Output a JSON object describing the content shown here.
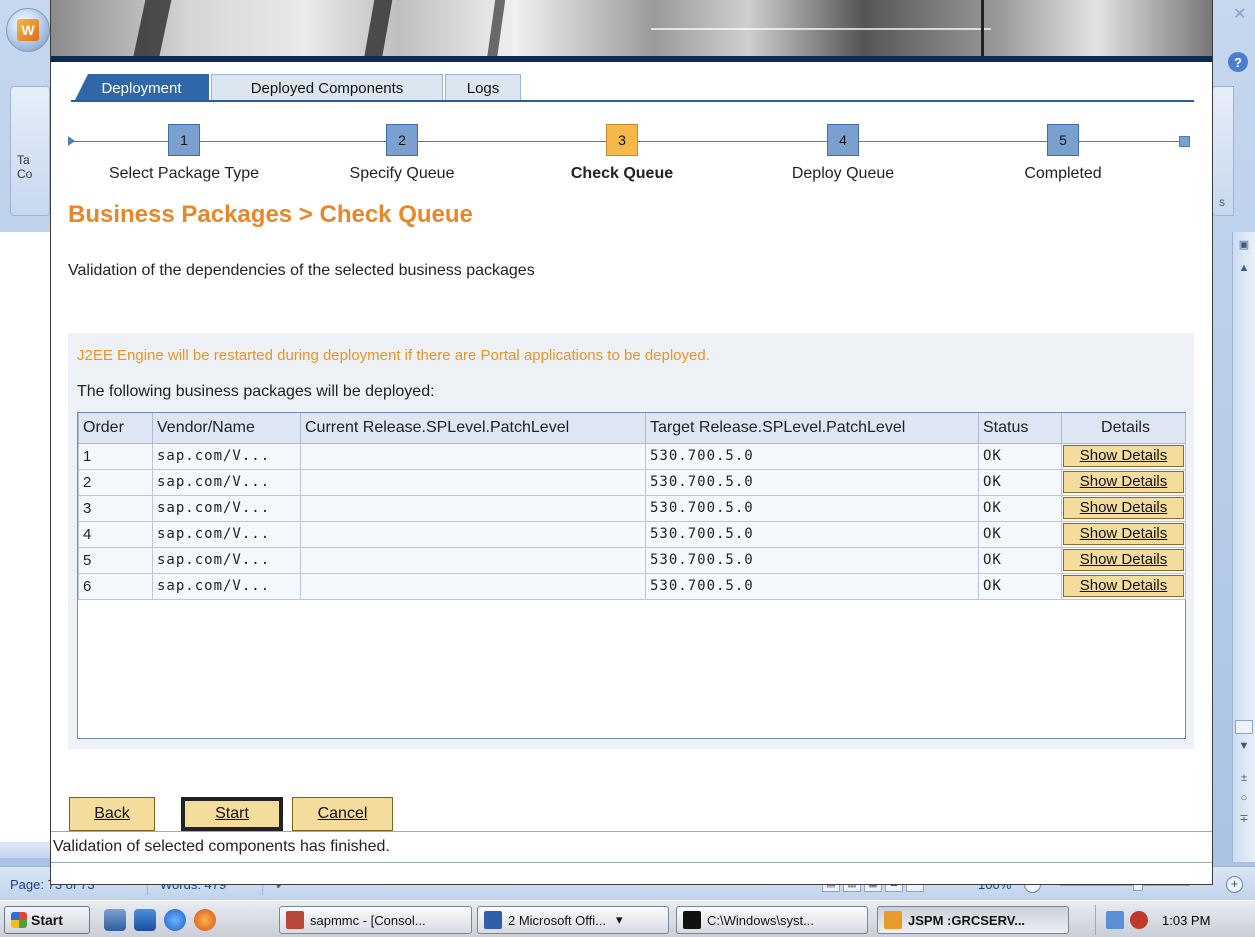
{
  "tabs": [
    "Deployment",
    "Deployed Components",
    "Logs"
  ],
  "roadmap": {
    "steps": [
      {
        "number": "1",
        "label": "Select Package Type"
      },
      {
        "number": "2",
        "label": "Specify Queue"
      },
      {
        "number": "3",
        "label": "Check Queue"
      },
      {
        "number": "4",
        "label": "Deploy Queue"
      },
      {
        "number": "5",
        "label": "Completed"
      }
    ],
    "current": 3
  },
  "page": {
    "title": "Business Packages > Check Queue",
    "description": "Validation of the dependencies of the selected business packages",
    "warning": "J2EE Engine will be restarted during deployment if there are Portal applications to be deployed.",
    "subheading": "The following business packages will be deployed:"
  },
  "table": {
    "columns": [
      "Order",
      "Vendor/Name",
      "Current Release.SPLevel.PatchLevel",
      "Target Release.SPLevel.PatchLevel",
      "Status",
      "Details"
    ],
    "rows": [
      {
        "order": "1",
        "vendor": "sap.com/V...",
        "current": "",
        "target": "530.700.5.0",
        "status": "OK",
        "details": "Show Details"
      },
      {
        "order": "2",
        "vendor": "sap.com/V...",
        "current": "",
        "target": "530.700.5.0",
        "status": "OK",
        "details": "Show Details"
      },
      {
        "order": "3",
        "vendor": "sap.com/V...",
        "current": "",
        "target": "530.700.5.0",
        "status": "OK",
        "details": "Show Details"
      },
      {
        "order": "4",
        "vendor": "sap.com/V...",
        "current": "",
        "target": "530.700.5.0",
        "status": "OK",
        "details": "Show Details"
      },
      {
        "order": "5",
        "vendor": "sap.com/V...",
        "current": "",
        "target": "530.700.5.0",
        "status": "OK",
        "details": "Show Details"
      },
      {
        "order": "6",
        "vendor": "sap.com/V...",
        "current": "",
        "target": "530.700.5.0",
        "status": "OK",
        "details": "Show Details"
      }
    ]
  },
  "buttons": {
    "back": "Back",
    "start": "Start",
    "cancel": "Cancel"
  },
  "message": "Validation of selected components has finished.",
  "word": {
    "ribbon_left": "Ta\nCo",
    "ribbon_right": "s",
    "page_info": "Page: 73 of 73",
    "words": "Words: 479",
    "zoom": "100%"
  },
  "taskbar": {
    "start": "Start",
    "items": [
      "sapmmc - [Consol...",
      "2 Microsoft Offi...",
      "C:\\Windows\\syst...",
      "JSPM :GRCSERV..."
    ],
    "clock": "1:03 PM"
  },
  "colors": {
    "accent_orange": "#e8872a",
    "tab_active": "#2f67a8",
    "step_current": "#f7b84a",
    "step": "#7aa0d0",
    "button": "#f3dc9c"
  }
}
